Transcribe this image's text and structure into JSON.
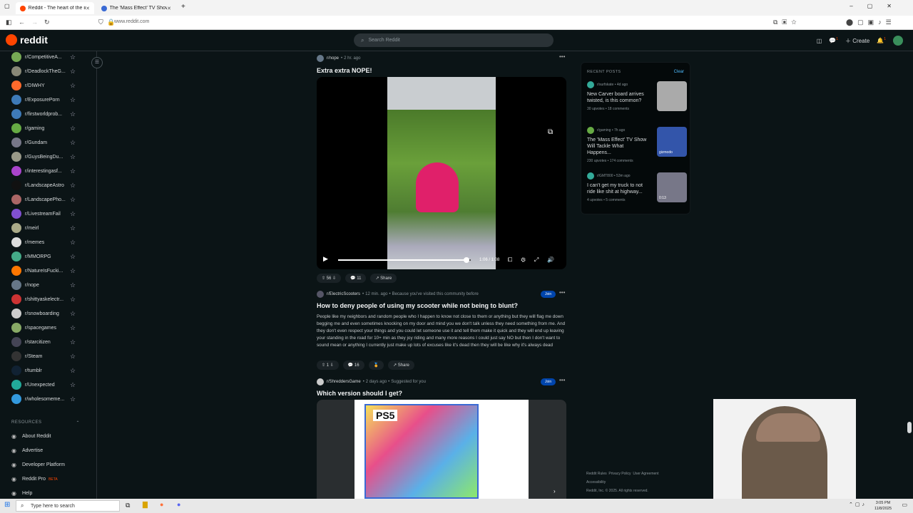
{
  "browser": {
    "tabs": [
      {
        "label": "Reddit - The heart of the intern",
        "active": true
      },
      {
        "label": "The 'Mass Effect' TV Show Will",
        "active": false
      }
    ],
    "new_tab": "+",
    "url": "www.reddit.com"
  },
  "header": {
    "logo": "reddit",
    "search_placeholder": "Search Reddit",
    "create": "Create",
    "chat_badge": "1",
    "notif_badge": "1"
  },
  "sidebar": {
    "communities": [
      {
        "name": "r/CompetitiveA...",
        "color": "#7a5"
      },
      {
        "name": "r/DeadlockTheG...",
        "color": "#887"
      },
      {
        "name": "r/DIWHY",
        "color": "#ff6a2c"
      },
      {
        "name": "r/ExposurePorn",
        "color": "#3e7ab8"
      },
      {
        "name": "r/firstworldprob...",
        "color": "#3e7ab8"
      },
      {
        "name": "r/gaming",
        "color": "#6a4"
      },
      {
        "name": "r/Gundam",
        "color": "#778"
      },
      {
        "name": "r/GuysBeingDu...",
        "color": "#998"
      },
      {
        "name": "r/interestingasf...",
        "color": "#a4c"
      },
      {
        "name": "r/LandscapeAstro",
        "color": "#111"
      },
      {
        "name": "r/LandscapePho...",
        "color": "#a66"
      },
      {
        "name": "r/LivestreamFail",
        "color": "#8050d0"
      },
      {
        "name": "r/meirl",
        "color": "#aa8"
      },
      {
        "name": "r/memes",
        "color": "#ddd"
      },
      {
        "name": "r/MMORPG",
        "color": "#4a8"
      },
      {
        "name": "r/NatureIsFucki...",
        "color": "#f70"
      },
      {
        "name": "r/nope",
        "color": "#678"
      },
      {
        "name": "r/shittyaskelectr...",
        "color": "#c33"
      },
      {
        "name": "r/snowboarding",
        "color": "#ccc"
      },
      {
        "name": "r/spacegames",
        "color": "#8a6"
      },
      {
        "name": "r/starcitizen",
        "color": "#445"
      },
      {
        "name": "r/Steam",
        "color": "#333"
      },
      {
        "name": "r/tumblr",
        "color": "#123"
      },
      {
        "name": "r/Unexpected",
        "color": "#2a9"
      },
      {
        "name": "r/wholesomeme...",
        "color": "#39d"
      }
    ],
    "resources_heading": "RESOURCES",
    "resources": [
      {
        "label": "About Reddit",
        "icon": "reddit-icon"
      },
      {
        "label": "Advertise",
        "icon": "megaphone-icon"
      },
      {
        "label": "Developer Platform",
        "icon": "code-icon"
      },
      {
        "label": "Reddit Pro",
        "icon": "pro-icon",
        "badge": "BETA"
      },
      {
        "label": "Help",
        "icon": "help-icon"
      }
    ]
  },
  "posts": [
    {
      "sub": "r/nope",
      "time": "2 hr. ago",
      "title": "Extra extra NOPE!",
      "video_time": "1:06 / 1:08",
      "progress": 0.97,
      "votes": "56",
      "comments": "11",
      "share": "Share"
    },
    {
      "sub": "r/ElectricScooters",
      "time": "12 min. ago",
      "reason": "Because you've visited this community before",
      "join": "Join",
      "title": "How to deny people of using my scooter while not being to blunt?",
      "body": "People like my neighbors and random people who I happen to know not close to them or anything but they will flag me down begging me and even sometimes knocking on my door and mind you we don't talk unless they need something from me. And they don't even respect your things and you could let someone use it and tell them make it quick and they will end up leaving your standing in the road for 10+ min as they joy riding and many more reasons I could just say NO but then I don't want to sound mean or anything I currently just make up lots of excuses like it's dead then they will be like why it's always dead",
      "votes": "1",
      "comments": "16",
      "share": "Share"
    },
    {
      "sub": "r/ShreddersGame",
      "time": "2 days ago",
      "reason": "Suggested for you",
      "join": "Join",
      "title": "Which version should I get?",
      "cover_text": "PS5"
    }
  ],
  "recent": {
    "heading": "RECENT POSTS",
    "clear": "Clear",
    "items": [
      {
        "sub": "r/surfskate",
        "time": "4d ago",
        "title": "New Carver board arrives twisted, is this common?",
        "upvotes": "30 upvotes",
        "comments": "18 comments",
        "thumb": "#aaa"
      },
      {
        "sub": "r/gaming",
        "time": "7h ago",
        "title": "The 'Mass Effect' TV Show Will Tackle What Happens...",
        "upvotes": "230 upvotes",
        "comments": "174 comments",
        "thumb": "#35a",
        "thumb_label": "gizmodo"
      },
      {
        "sub": "r/GMT800",
        "time": "53m ago",
        "title": "I can't get my truck to not ride like shit at highway...",
        "upvotes": "4 upvotes",
        "comments": "5 comments",
        "thumb": "#778",
        "thumb_label": "0:13"
      }
    ]
  },
  "footer": {
    "links": [
      "Reddit Rules",
      "Privacy Policy",
      "User Agreement"
    ],
    "accessibility": "Accessibility",
    "copyright": "Reddit, Inc. © 2025. All rights reserved."
  },
  "taskbar": {
    "search_placeholder": "Type here to search",
    "time": "3:05 PM",
    "date": "11/8/2025"
  }
}
